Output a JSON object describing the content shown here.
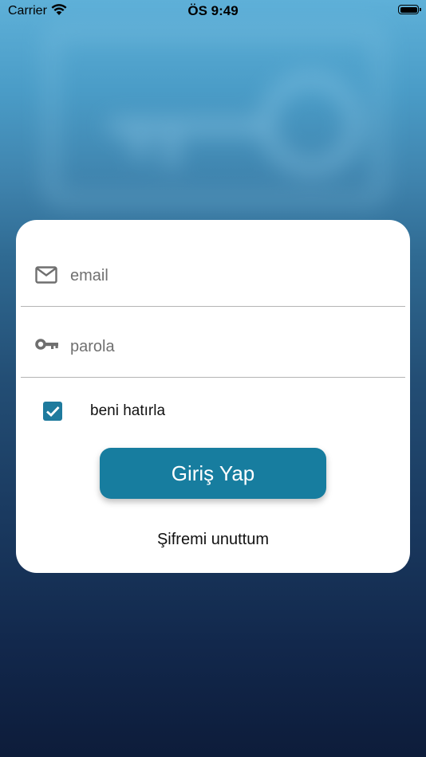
{
  "status_bar": {
    "carrier": "Carrier",
    "time": "ÖS 9:49"
  },
  "login_form": {
    "email_placeholder": "email",
    "password_placeholder": "parola",
    "remember_label": "beni hatırla",
    "remember_checked": true,
    "login_button": "Giriş Yap",
    "forgot_link": "Şifremi unuttum"
  },
  "icons": {
    "email": "envelope-icon",
    "password": "key-icon",
    "checkbox": "checkmark-icon",
    "wifi": "wifi-icon",
    "battery": "battery-icon"
  },
  "colors": {
    "accent": "#177d9f",
    "checkbox": "#1e7a9d",
    "card": "#ffffff"
  }
}
